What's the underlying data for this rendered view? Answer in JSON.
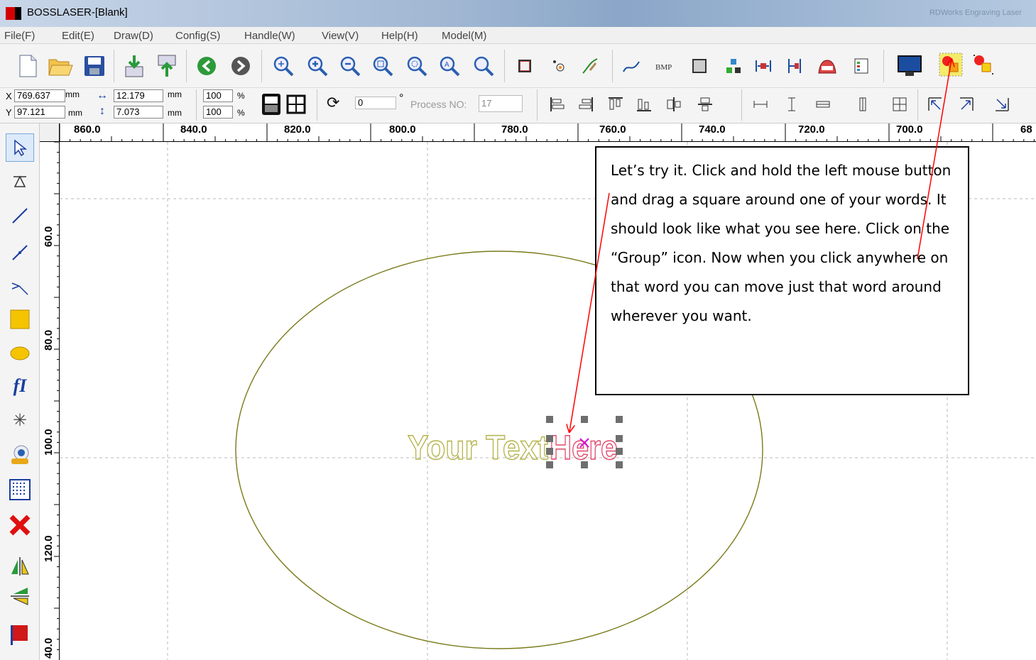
{
  "window": {
    "title": "BOSSLASER-[Blank]",
    "title_right": "RDWorks Engraving Laser"
  },
  "menu": [
    {
      "label": "File(F)"
    },
    {
      "label": "Edit(E)"
    },
    {
      "label": "Draw(D)"
    },
    {
      "label": "Config(S)"
    },
    {
      "label": "Handle(W)"
    },
    {
      "label": "View(V)"
    },
    {
      "label": "Help(H)"
    },
    {
      "label": "Model(M)"
    }
  ],
  "coords": {
    "x_label": "X",
    "x_value": "769.637",
    "y_label": "Y",
    "y_value": "97.121",
    "unit_mm": "mm",
    "width_value": "12.179",
    "height_value": "7.073",
    "scale_x": "100",
    "scale_y": "100",
    "percent": "%",
    "rotate_value": "0",
    "degree": "°",
    "process_label": "Process NO:",
    "process_value": "17"
  },
  "ruler_h": [
    "860.0",
    "840.0",
    "820.0",
    "800.0",
    "780.0",
    "760.0",
    "740.0",
    "720.0",
    "700.0",
    "68"
  ],
  "ruler_v": [
    "60.0",
    "80.0",
    "100.0",
    "120.0",
    "40.0"
  ],
  "canvas": {
    "text_left": "Your Text",
    "text_selected": "Here"
  },
  "callout": {
    "text": "Let’s try it.  Click and hold the left mouse button and drag a square around one of your words.  It should look like what you see here.  Click on the “Group” icon.  Now when you click anywhere on that word you can move just that word around wherever you want."
  },
  "colors": {
    "ellipse": "#7a7a1a",
    "text_outline": "#b5b34a",
    "selected_text": "#e0476a",
    "arrow": "#ff0000"
  }
}
